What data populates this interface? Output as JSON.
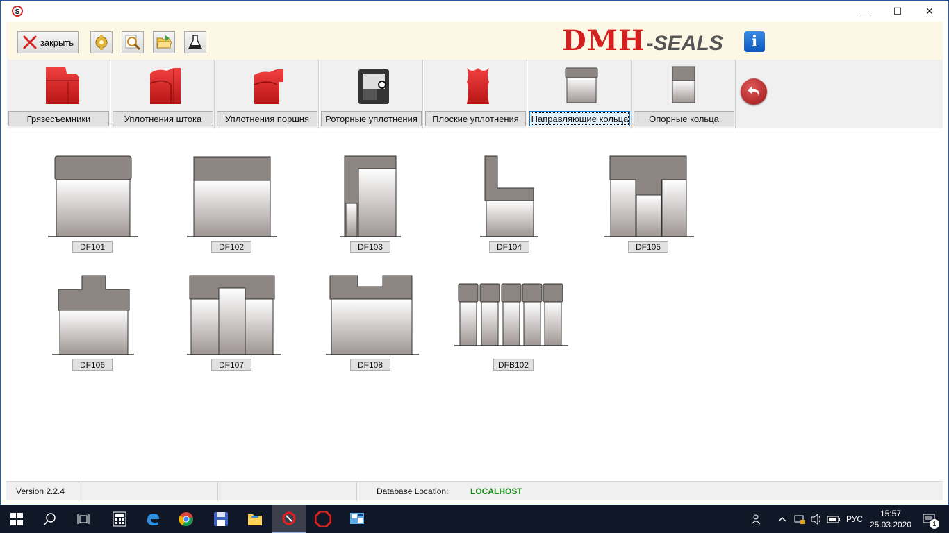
{
  "window": {
    "controls": {
      "minimize": "—",
      "maximize": "☐",
      "close": "✕"
    }
  },
  "toolbar": {
    "close_label": "закрыть",
    "logo_main": "DMH",
    "logo_sub": "-SEALS",
    "info_label": "i"
  },
  "categories": [
    {
      "label": "Грязесъемники"
    },
    {
      "label": "Уплотнения штока"
    },
    {
      "label": "Уплотнения поршня"
    },
    {
      "label": "Роторные уплотнения"
    },
    {
      "label": "Плоские уплотнения"
    },
    {
      "label": "Направляющие кольца",
      "selected": true
    },
    {
      "label": "Опорные кольца"
    }
  ],
  "products": [
    {
      "label": "DF101",
      "icon": "df101-profile-icon"
    },
    {
      "label": "DF102",
      "icon": "df102-profile-icon"
    },
    {
      "label": "DF103",
      "icon": "df103-profile-icon"
    },
    {
      "label": "DF104",
      "icon": "df104-profile-icon"
    },
    {
      "label": "DF105",
      "icon": "df105-profile-icon"
    },
    {
      "label": "DF106",
      "icon": "df106-profile-icon"
    },
    {
      "label": "DF107",
      "icon": "df107-profile-icon"
    },
    {
      "label": "DF108",
      "icon": "df108-profile-icon"
    },
    {
      "label": "DFB102",
      "icon": "dfb102-profile-icon"
    }
  ],
  "status": {
    "version": "Version 2.2.4",
    "db_label": "Database Location:",
    "db_value": "LOCALHOST"
  },
  "taskbar": {
    "lang": "РУС",
    "time": "15:57",
    "date": "25.03.2020",
    "notifications": "1"
  },
  "colors": {
    "brand_red": "#d41f1f",
    "seal_gray": "#8c8582",
    "seal_red": "#dc2a2a",
    "status_green": "#1a8a1a",
    "taskbar": "#101827"
  }
}
